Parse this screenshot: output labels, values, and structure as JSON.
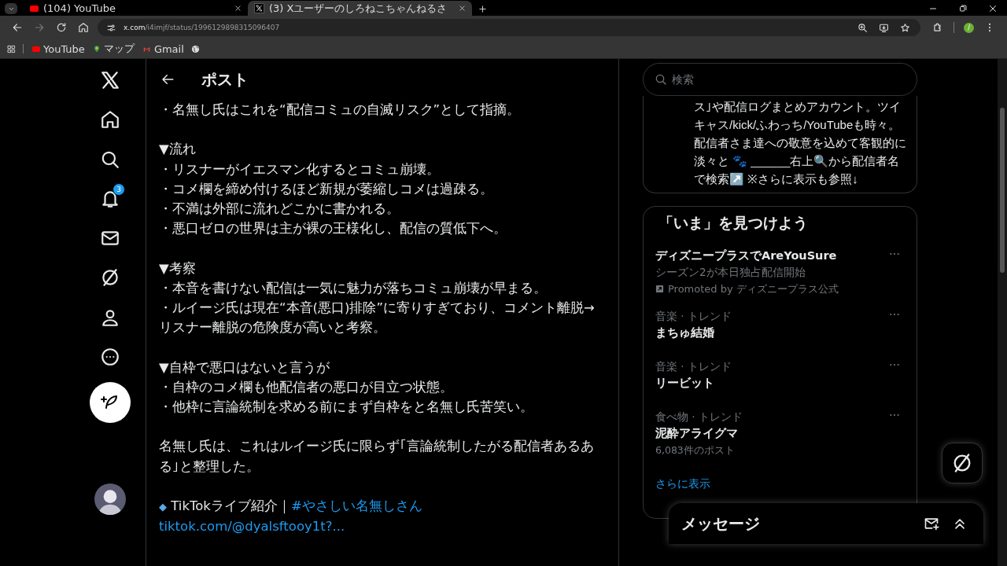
{
  "browser": {
    "tabs": [
      {
        "title": "(104) YouTube",
        "selected": false
      },
      {
        "title": "(3) Xユーザーのしろねこちゃんねるさ",
        "selected": true
      }
    ],
    "address": {
      "host": "x.com",
      "path": "/i4imjf/status/1996129898315096407"
    },
    "bookmarks": [
      {
        "label": "YouTube"
      },
      {
        "label": "マップ"
      },
      {
        "label": "Gmail"
      }
    ],
    "profile_initial": "/"
  },
  "notification_badge": "3",
  "post": {
    "title": "ポスト",
    "blocks": [
      {
        "kind": "lines",
        "lines": [
          "・名無し氏はこれを“配信コミュの自滅リスク”として指摘。"
        ]
      },
      {
        "kind": "lines",
        "lines": [
          "▼流れ",
          "・リスナーがイエスマン化するとコミュ崩壊。",
          "・コメ欄を締め付けるほど新規が萎縮しコメは過疎る。",
          "・不満は外部に流れどこかに書かれる。",
          "・悪口ゼロの世界は主が裸の王様化し、配信の質低下へ。"
        ]
      },
      {
        "kind": "lines",
        "lines": [
          "▼考察",
          "・本音を書けない配信は一気に魅力が落ちコミュ崩壊が早まる。",
          "・ルイージ氏は現在“本音(悪口)排除”に寄りすぎており、コメント離脱→リスナー離脱の危険度が高いと考察。"
        ]
      },
      {
        "kind": "lines",
        "lines": [
          "▼自枠で悪口はないと言うが",
          "・自枠のコメ欄も他配信者の悪口が目立つ状態。",
          "・他枠に言論統制を求める前にまず自枠をと名無し氏苦笑い。"
        ]
      },
      {
        "kind": "lines",
        "lines": [
          "名無し氏は、これはルイージ氏に限らず｢言論統制したがる配信者あるある｣と整理した。"
        ]
      },
      {
        "kind": "promo",
        "bullet": "◆",
        "label": "TikTokライブ紹介｜",
        "hashtag": "#やさしい名無しさん",
        "url": "tiktok.com/@dyalsftooy1t?..."
      }
    ]
  },
  "search": {
    "placeholder": "検索"
  },
  "bio": "ス｣や配信ログまとめアカウント。ツイキャス/kick/ふわっち/YouTubeも時々。配信者さま達への敬意を込めて客観的に淡々と 🐾 ______右上🔍から配信者名で検索↗️ ※さらに表示も参照↓",
  "trends": {
    "title": "「いま」を見つけよう",
    "items": [
      {
        "kind": "promoted",
        "title": "ディズニープラスでAreYouSure",
        "subtitle": "シーズン2が本日独占配信開始",
        "promoted_by": "Promoted by ディズニープラス公式"
      },
      {
        "kind": "trend",
        "category": "音楽 · トレンド",
        "title": "まちゅ結婚"
      },
      {
        "kind": "trend",
        "category": "音楽 · トレンド",
        "title": "リービット"
      },
      {
        "kind": "trend",
        "category": "食べ物 · トレンド",
        "title": "泥酔アライグマ",
        "count": "6,083件のポスト"
      }
    ],
    "more": "さらに表示"
  },
  "messages": {
    "title": "メッセージ"
  }
}
